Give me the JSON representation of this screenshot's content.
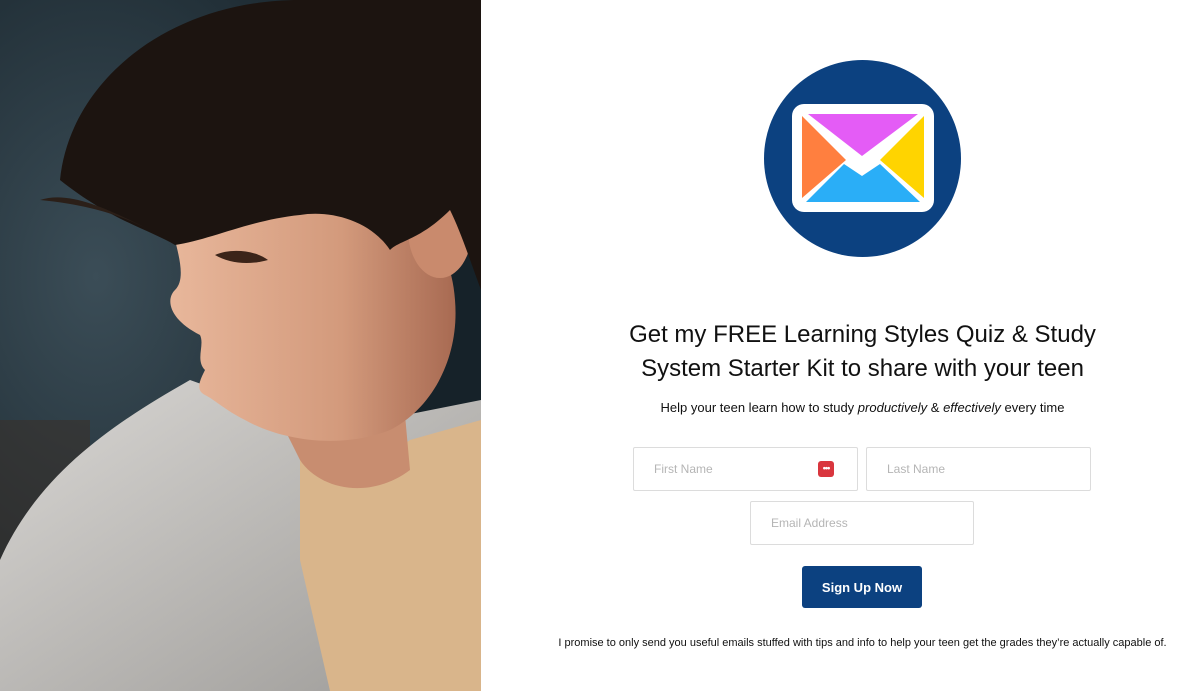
{
  "brand": {
    "logo_icon": "envelope-icon",
    "logo_bg": "#0c4180",
    "button_color": "#0c4180",
    "alert_icon_color": "#d9363e"
  },
  "headline": {
    "line1": "Get my FREE Learning Styles Quiz & Study",
    "line2": "System Starter Kit to share with your teen"
  },
  "subline": {
    "before": "Help your teen learn how to study ",
    "em1": "productively",
    "mid": " & ",
    "em2": "effectively",
    "after": " every time"
  },
  "form": {
    "first_name_placeholder": "First Name",
    "last_name_placeholder": "Last Name",
    "email_placeholder": "Email Address",
    "password_manager_icon": "password-manager-icon",
    "password_manager_glyph": "•••",
    "submit_label": "Sign Up Now"
  },
  "promise_text": "I promise to only send you useful emails stuffed with tips and info to help your teen get the grades they’re actually capable of."
}
